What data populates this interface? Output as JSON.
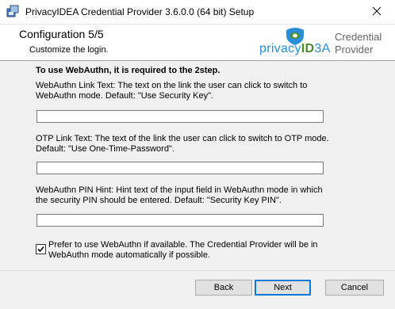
{
  "window": {
    "title": "PrivacyIDEA Credential Provider 3.6.0.0 (64 bit) Setup",
    "app_icon": "installer-icon",
    "close_icon": "close-icon"
  },
  "header": {
    "title": "Configuration 5/5",
    "subtitle": "Customize the login.",
    "logo": {
      "word_part1": "privacy",
      "word_part2": "ID",
      "word_part3": "3A",
      "tagline_line1": "Credential",
      "tagline_line2": "Provider"
    }
  },
  "form": {
    "heading": "To use WebAuthn, it is required to the 2step.",
    "webauthn_link": {
      "description": "WebAuthn Link Text: The text on the link the user can click to switch to WebAuthn mode. Default: \"Use Security Key\".",
      "value": ""
    },
    "otp_link": {
      "description": "OTP Link Text: The text of the link the user can click to switch to OTP mode. Default: \"Use One-Time-Password\".",
      "value": ""
    },
    "pin_hint": {
      "description": "WebAuthn PIN Hint: Hint text of the input field in WebAuthn mode in which the security PIN should be entered. Default: \"Security Key PIN\".",
      "value": ""
    },
    "prefer_webauthn": {
      "label": "Prefer to use WebAuthn if available. The Credential Provider will be in WebAuthn mode automatically if possible.",
      "checked": true
    }
  },
  "buttons": {
    "back": "Back",
    "next": "Next",
    "cancel": "Cancel"
  },
  "colors": {
    "accent": "#0078d7",
    "logo_blue": "#2a8fd6",
    "logo_green": "#4c8c2b"
  }
}
